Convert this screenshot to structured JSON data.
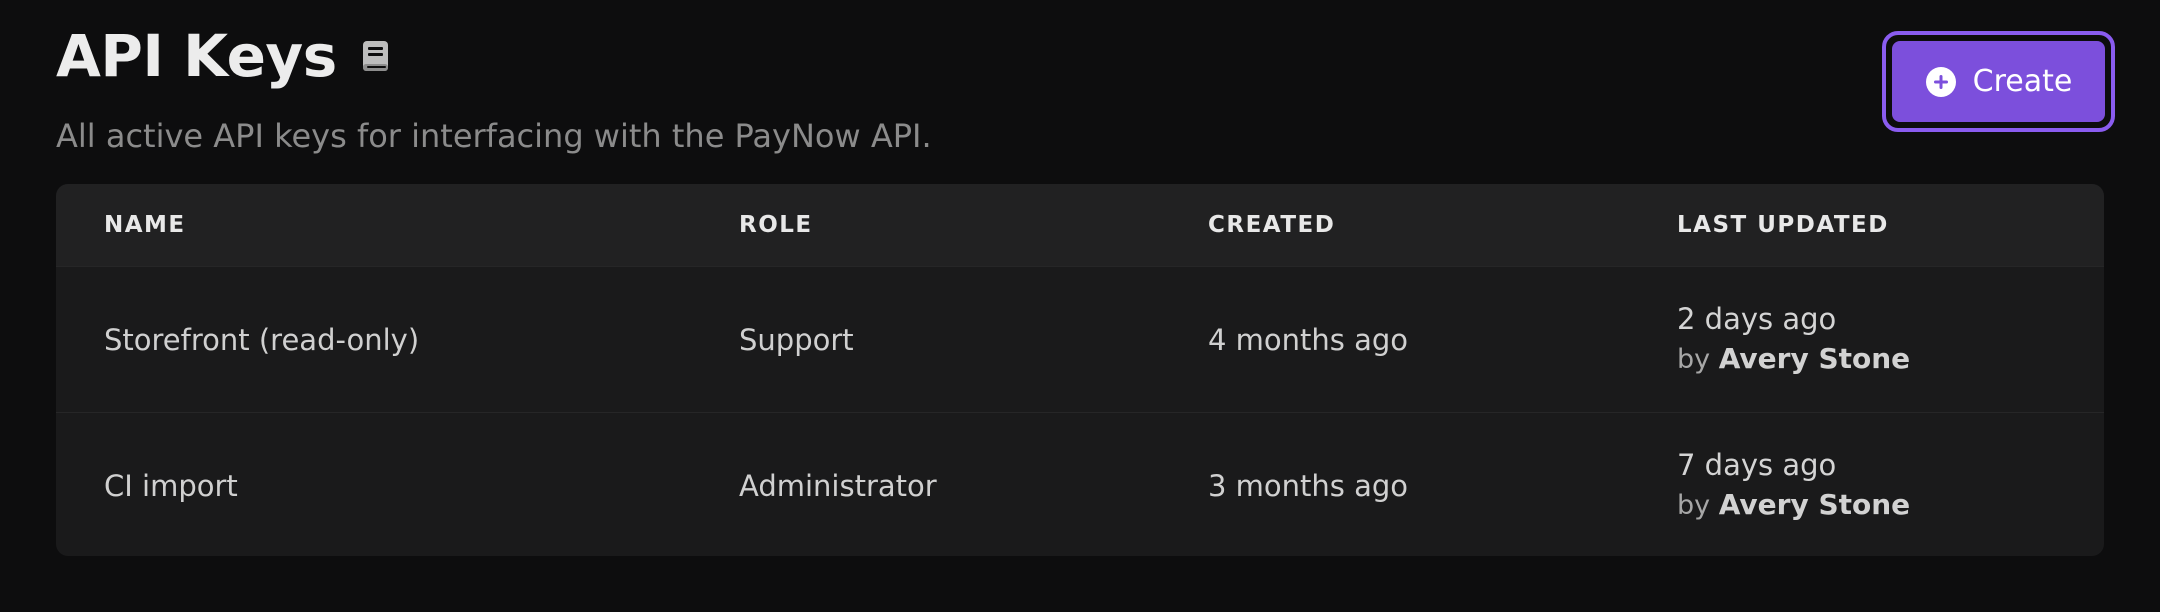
{
  "header": {
    "title": "API Keys",
    "title_icon": "book-icon",
    "subtitle": "All active API keys for interfacing with the PayNow API."
  },
  "actions": {
    "create_label": "Create",
    "create_icon": "plus-circle-icon",
    "accent_color": "#7c4fdc"
  },
  "table": {
    "columns": [
      "NAME",
      "ROLE",
      "CREATED",
      "LAST UPDATED"
    ],
    "rows": [
      {
        "name": "Storefront (read-only)",
        "role": "Support",
        "created": "4 months ago",
        "updated": "2 days ago",
        "updated_by_prefix": "by",
        "updated_by": "Avery Stone"
      },
      {
        "name": "CI import",
        "role": "Administrator",
        "created": "3 months ago",
        "updated": "7 days ago",
        "updated_by_prefix": "by",
        "updated_by": "Avery Stone"
      }
    ]
  }
}
